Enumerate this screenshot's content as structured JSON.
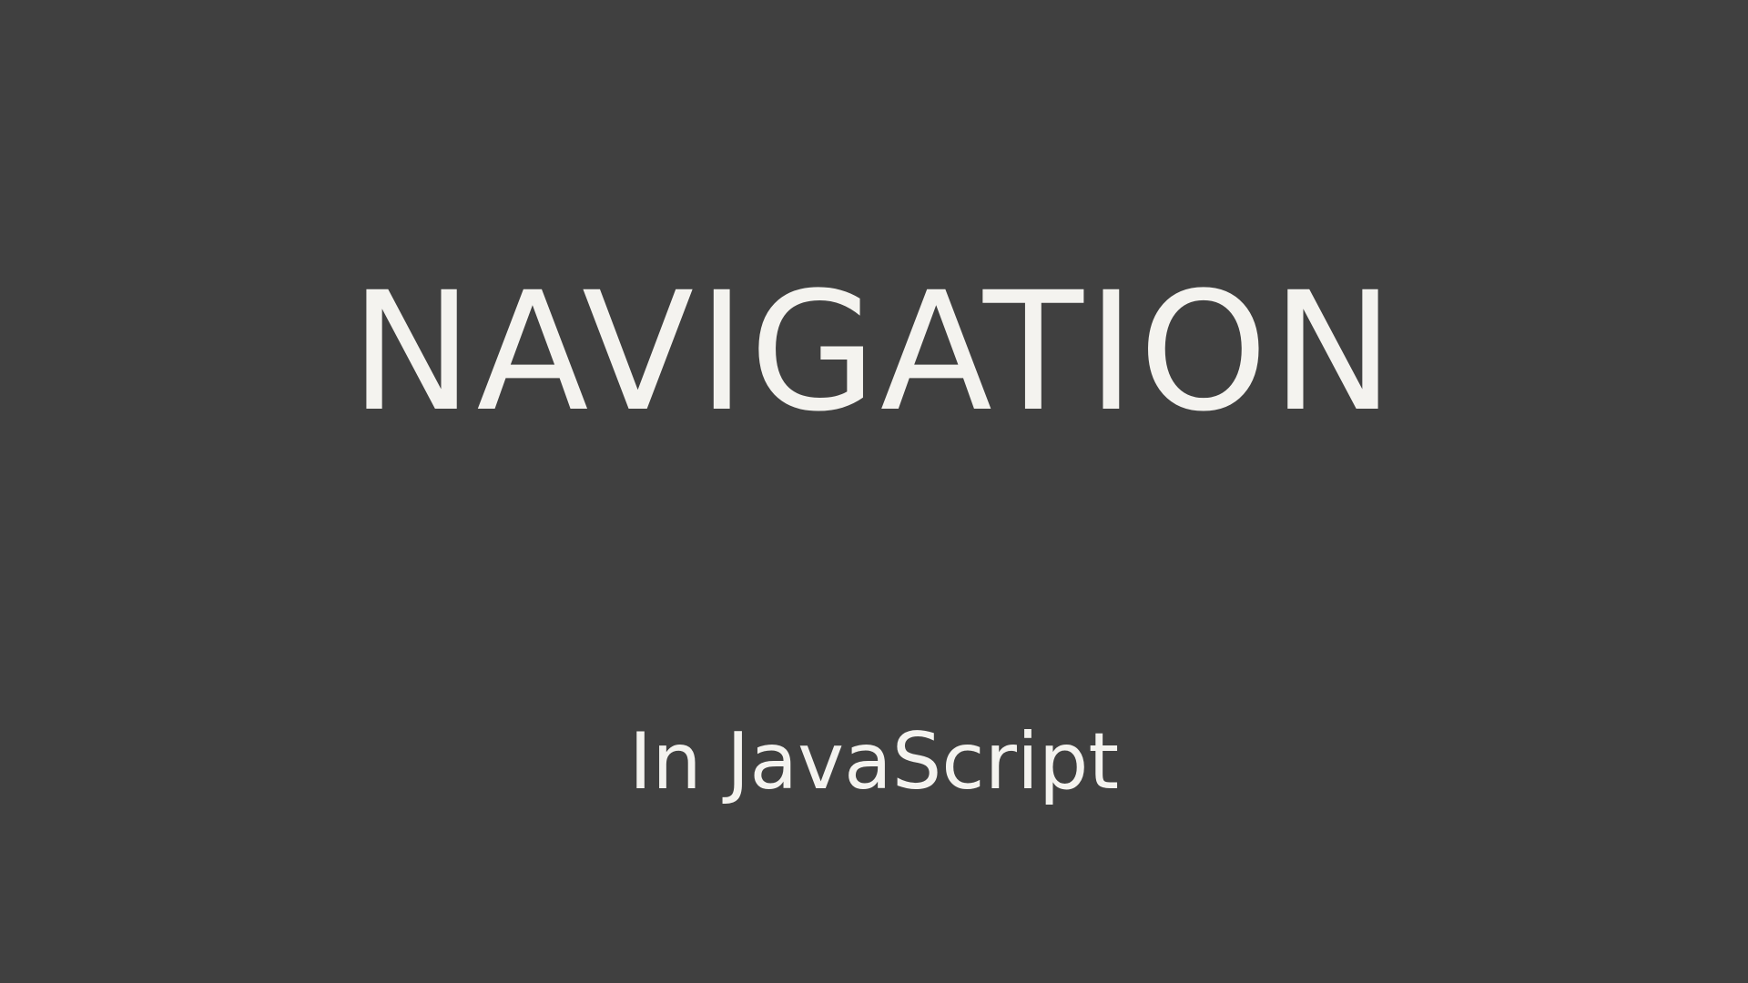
{
  "slide": {
    "title": "NAVIGATION",
    "subtitle": "In JavaScript",
    "background_color": "#404040",
    "text_color": "#f4f3ef"
  }
}
